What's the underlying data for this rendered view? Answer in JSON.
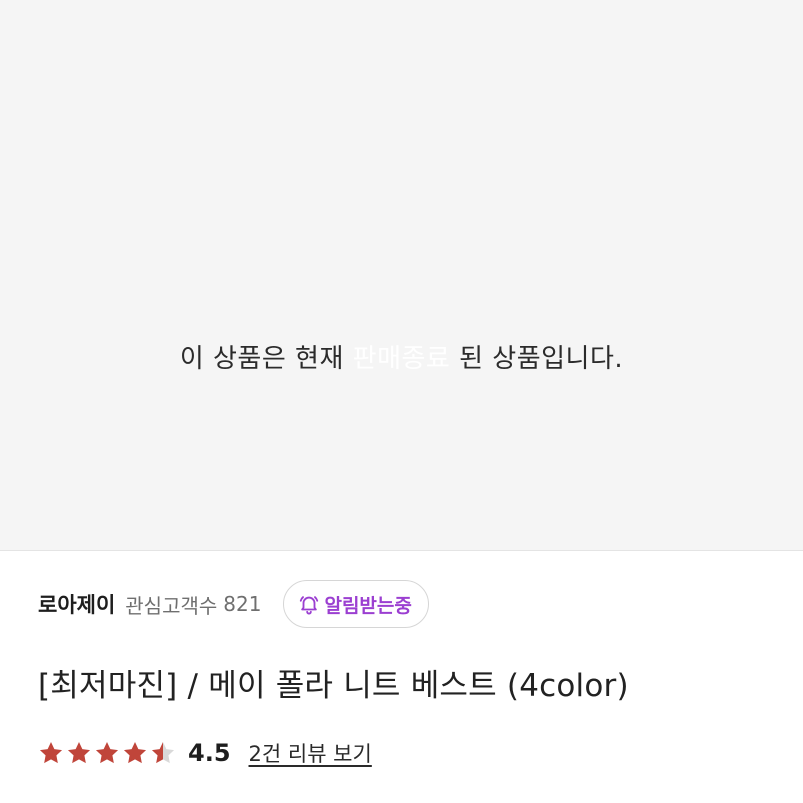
{
  "product_image": {
    "status_message_before": "이 상품은 현재 ",
    "status_message_highlight": "판매종료",
    "status_message_after": " 된 상품입니다.",
    "highlight_color": "#ffffff"
  },
  "shop": {
    "name": "로아제이",
    "watch_label": "관심고객수",
    "watch_count": "821",
    "alarm_button_label": "알림받는중",
    "alarm_color": "#9b3fd1"
  },
  "product": {
    "title": "[최저마진] / 메이 폴라 니트 베스트 (4color)"
  },
  "rating": {
    "score": "4.5",
    "score_value": 4.5,
    "max": 5,
    "star_color": "#c0453a",
    "review_link": "2건 리뷰 보기"
  }
}
